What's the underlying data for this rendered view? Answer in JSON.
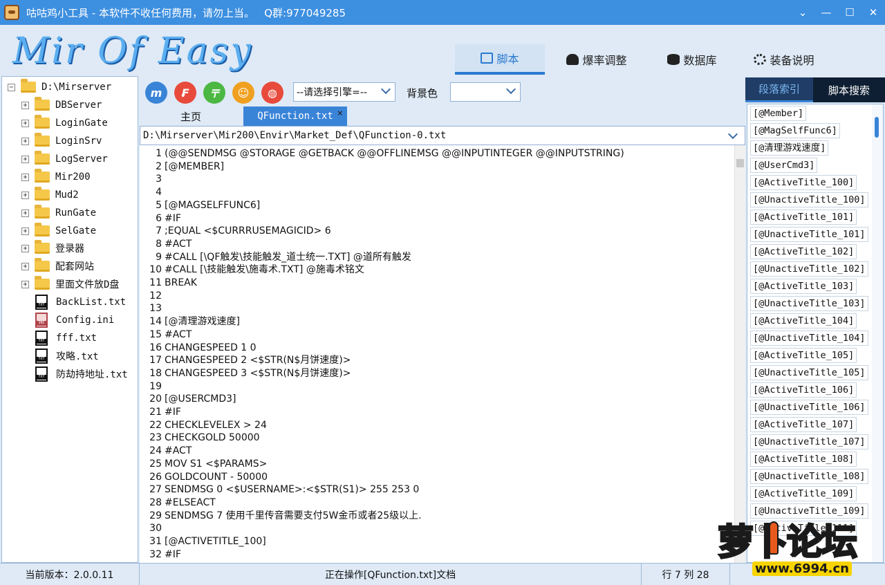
{
  "window": {
    "title": "咕咕鸡小工具 - 本软件不收任何费用，请勿上当。   Q群:977049285"
  },
  "logo": {
    "text": "Mir Of Easy"
  },
  "main_tabs": [
    {
      "label": "脚本",
      "icon": "monitor-icon"
    },
    {
      "label": "爆率调整",
      "icon": "chip-icon"
    },
    {
      "label": "数据库",
      "icon": "database-icon"
    },
    {
      "label": "装备说明",
      "icon": "gear-icon"
    }
  ],
  "tree": {
    "root": "D:\\Mirserver",
    "folders": [
      "DBServer",
      "LoginGate",
      "LoginSrv",
      "LogServer",
      "Mir200",
      "Mud2",
      "RunGate",
      "SelGate",
      "登录器",
      "配套网站",
      "里面文件放D盘"
    ],
    "files": [
      {
        "name": "BackList.txt",
        "type": "txt"
      },
      {
        "name": "Config.ini",
        "type": "ini"
      },
      {
        "name": "fff.txt",
        "type": "txt"
      },
      {
        "name": "攻略.txt",
        "type": "txt"
      },
      {
        "name": "防劫持地址.txt",
        "type": "txt"
      }
    ]
  },
  "toolbar": {
    "buttons": [
      {
        "glyph": "m",
        "color": "#3a84d8",
        "name": "m-tool-button"
      },
      {
        "glyph": "₣",
        "color": "#e84a3c",
        "name": "f-tool-button"
      },
      {
        "glyph": "〒",
        "color": "#4cb843",
        "name": "t-tool-button"
      },
      {
        "glyph": "☺",
        "color": "#f0a020",
        "name": "face-tool-button"
      },
      {
        "glyph": "◍",
        "color": "#e84a3c",
        "name": "o-tool-button"
      }
    ],
    "engine_select": "--请选择引擎=--",
    "bg_label": "背景色",
    "bg_select": ""
  },
  "editor_tabs": [
    {
      "label": "主页"
    },
    {
      "label": "QFunction.txt",
      "close": "×"
    }
  ],
  "path": "D:\\Mirserver\\Mir200\\Envir\\Market_Def\\QFunction-0.txt",
  "code_lines": [
    "(@@SENDMSG @STORAGE @GETBACK @@OFFLINEMSG @@INPUTINTEGER @@INPUTSTRING)",
    "[@MEMBER]",
    "",
    "",
    "[@MAGSELFFUNC6]",
    "#IF",
    ";EQUAL <$CURRRUSEMAGICID> 6",
    "#ACT",
    "#CALL [\\QF触发\\技能触发_道士统一.TXT] @道所有触发",
    "#CALL [\\技能触发\\施毒术.TXT] @施毒术铭文",
    "BREAK",
    "",
    "",
    "[@清理游戏速度]",
    "#ACT",
    "CHANGESPEED 1 0",
    "CHANGESPEED 2 <$STR(N$月饼速度)>",
    "CHANGESPEED 3 <$STR(N$月饼速度)>",
    "",
    "[@USERCMD3]",
    "#IF",
    "CHECKLEVELEX > 24",
    "CHECKGOLD 50000",
    "#ACT",
    "MOV S1 <$PARAMS>",
    "GOLDCOUNT - 50000",
    "SENDMSG 0 <$USERNAME>:<$STR(S1)> 255 253 0",
    "#ELSEACT",
    "SENDMSG 7 使用千里传音需要支付5W金币或者25级以上.",
    "",
    "[@ACTIVETITLE_100]",
    "#IF"
  ],
  "side_tabs": [
    {
      "label": "段落索引"
    },
    {
      "label": "脚本搜索"
    }
  ],
  "index_items": [
    "[@Member]",
    "[@MagSelfFunc6]",
    "[@清理游戏速度]",
    "[@UserCmd3]",
    "[@ActiveTitle_100]",
    "[@UnactiveTitle_100]",
    "[@ActiveTitle_101]",
    "[@UnactiveTitle_101]",
    "[@ActiveTitle_102]",
    "[@UnactiveTitle_102]",
    "[@ActiveTitle_103]",
    "[@UnactiveTitle_103]",
    "[@ActiveTitle_104]",
    "[@UnactiveTitle_104]",
    "[@ActiveTitle_105]",
    "[@UnactiveTitle_105]",
    "[@ActiveTitle_106]",
    "[@UnactiveTitle_106]",
    "[@ActiveTitle_107]",
    "[@UnactiveTitle_107]",
    "[@ActiveTitle_108]",
    "[@UnactiveTitle_108]",
    "[@ActiveTitle_109]",
    "[@UnactiveTitle_109]",
    "[@ActiveTitle_111]"
  ],
  "status": {
    "version": "当前版本：2.0.0.11",
    "operation": "正在操作[QFunction.txt]文档",
    "position": "行 7 列 28"
  },
  "watermark": {
    "text": "萝卜论坛",
    "url": "www.6994.cn"
  }
}
